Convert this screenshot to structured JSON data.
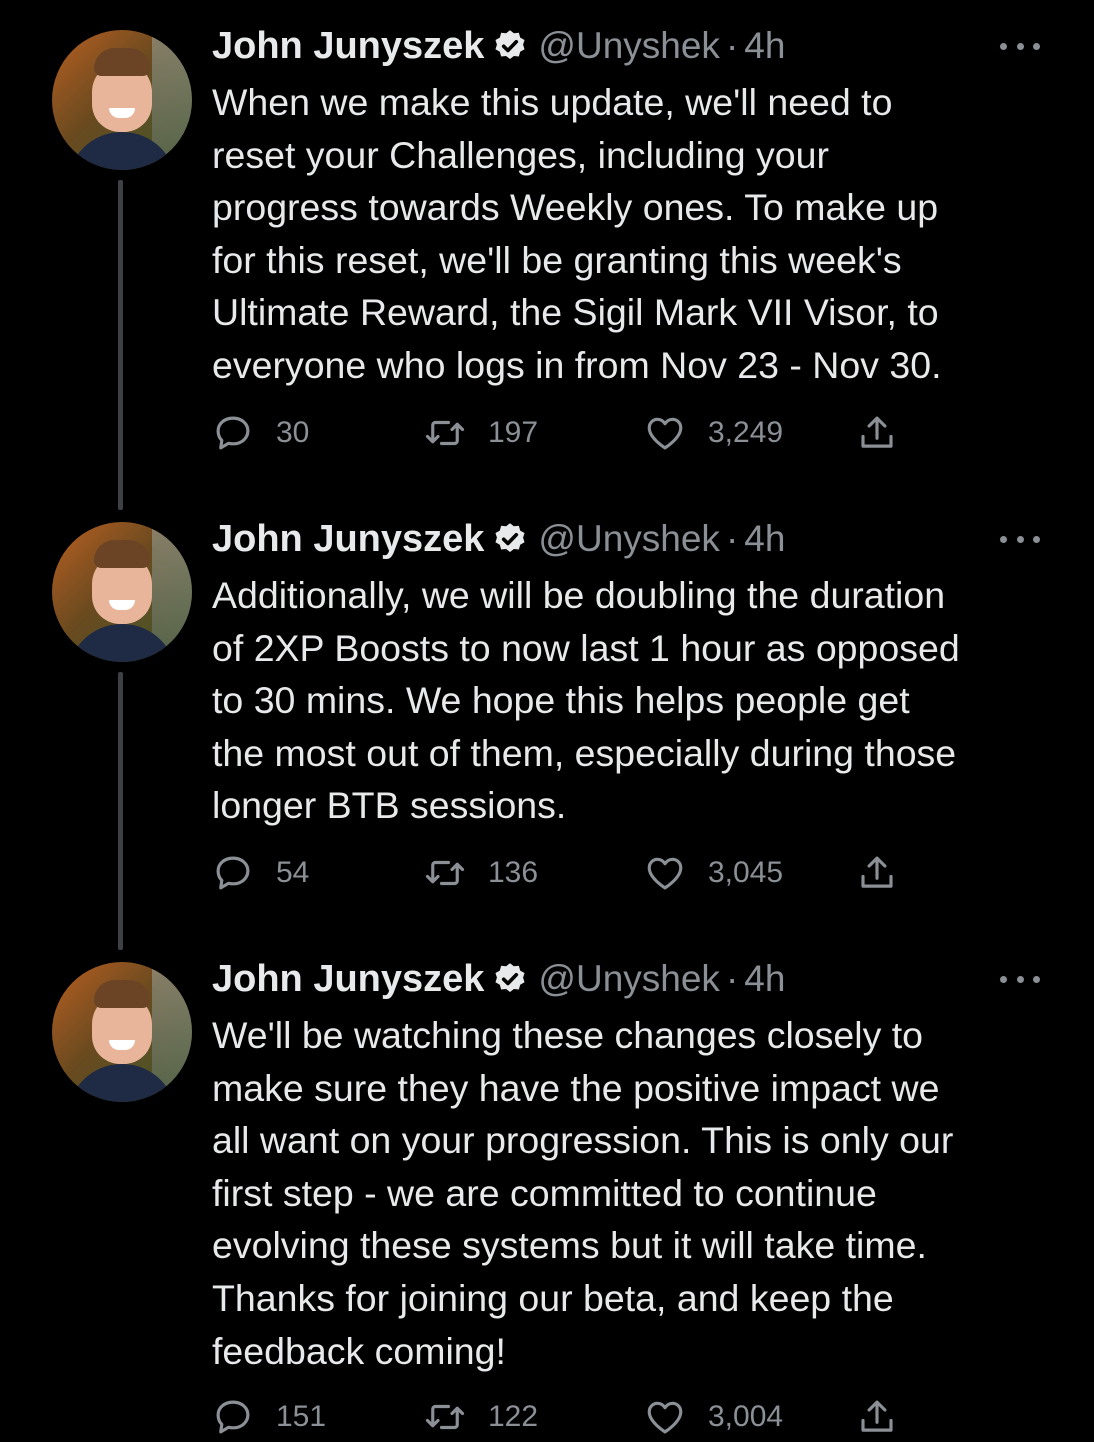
{
  "tweets": [
    {
      "author_name": "John Junyszek",
      "handle": "@Unyshek",
      "separator": "·",
      "time": "4h",
      "text": "When we make this update, we'll need to\nreset your Challenges, including your\nprogress towards Weekly ones. To make up\nfor this reset, we'll be granting this week's\nUltimate Reward, the Sigil Mark VII Visor, to\neveryone who logs in from Nov 23 - Nov 30.",
      "replies": "30",
      "retweets": "197",
      "likes": "3,249"
    },
    {
      "author_name": "John Junyszek",
      "handle": "@Unyshek",
      "separator": "·",
      "time": "4h",
      "text": "Additionally, we will be doubling the duration\nof 2XP Boosts to now last 1 hour as opposed\nto 30 mins. We hope this helps people get\nthe most out of them, especially during those\nlonger BTB sessions.",
      "replies": "54",
      "retweets": "136",
      "likes": "3,045"
    },
    {
      "author_name": "John Junyszek",
      "handle": "@Unyshek",
      "separator": "·",
      "time": "4h",
      "text": "We'll be watching these changes closely to\nmake sure they have the positive impact we\nall want on your progression. This is only our\nfirst step - we are committed to continue\nevolving these systems but it will take time.\nThanks for joining our beta, and keep the\nfeedback coming!",
      "replies": "151",
      "retweets": "122",
      "likes": "3,004"
    }
  ],
  "icons": {
    "verified": "verified-badge-icon",
    "more": "more-options-icon",
    "reply": "reply-icon",
    "retweet": "retweet-icon",
    "like": "heart-icon",
    "share": "share-icon"
  },
  "colors": {
    "background": "#000000",
    "text_primary": "#e7e9ea",
    "text_secondary": "#8b9096",
    "thread_line": "#3e4144"
  }
}
